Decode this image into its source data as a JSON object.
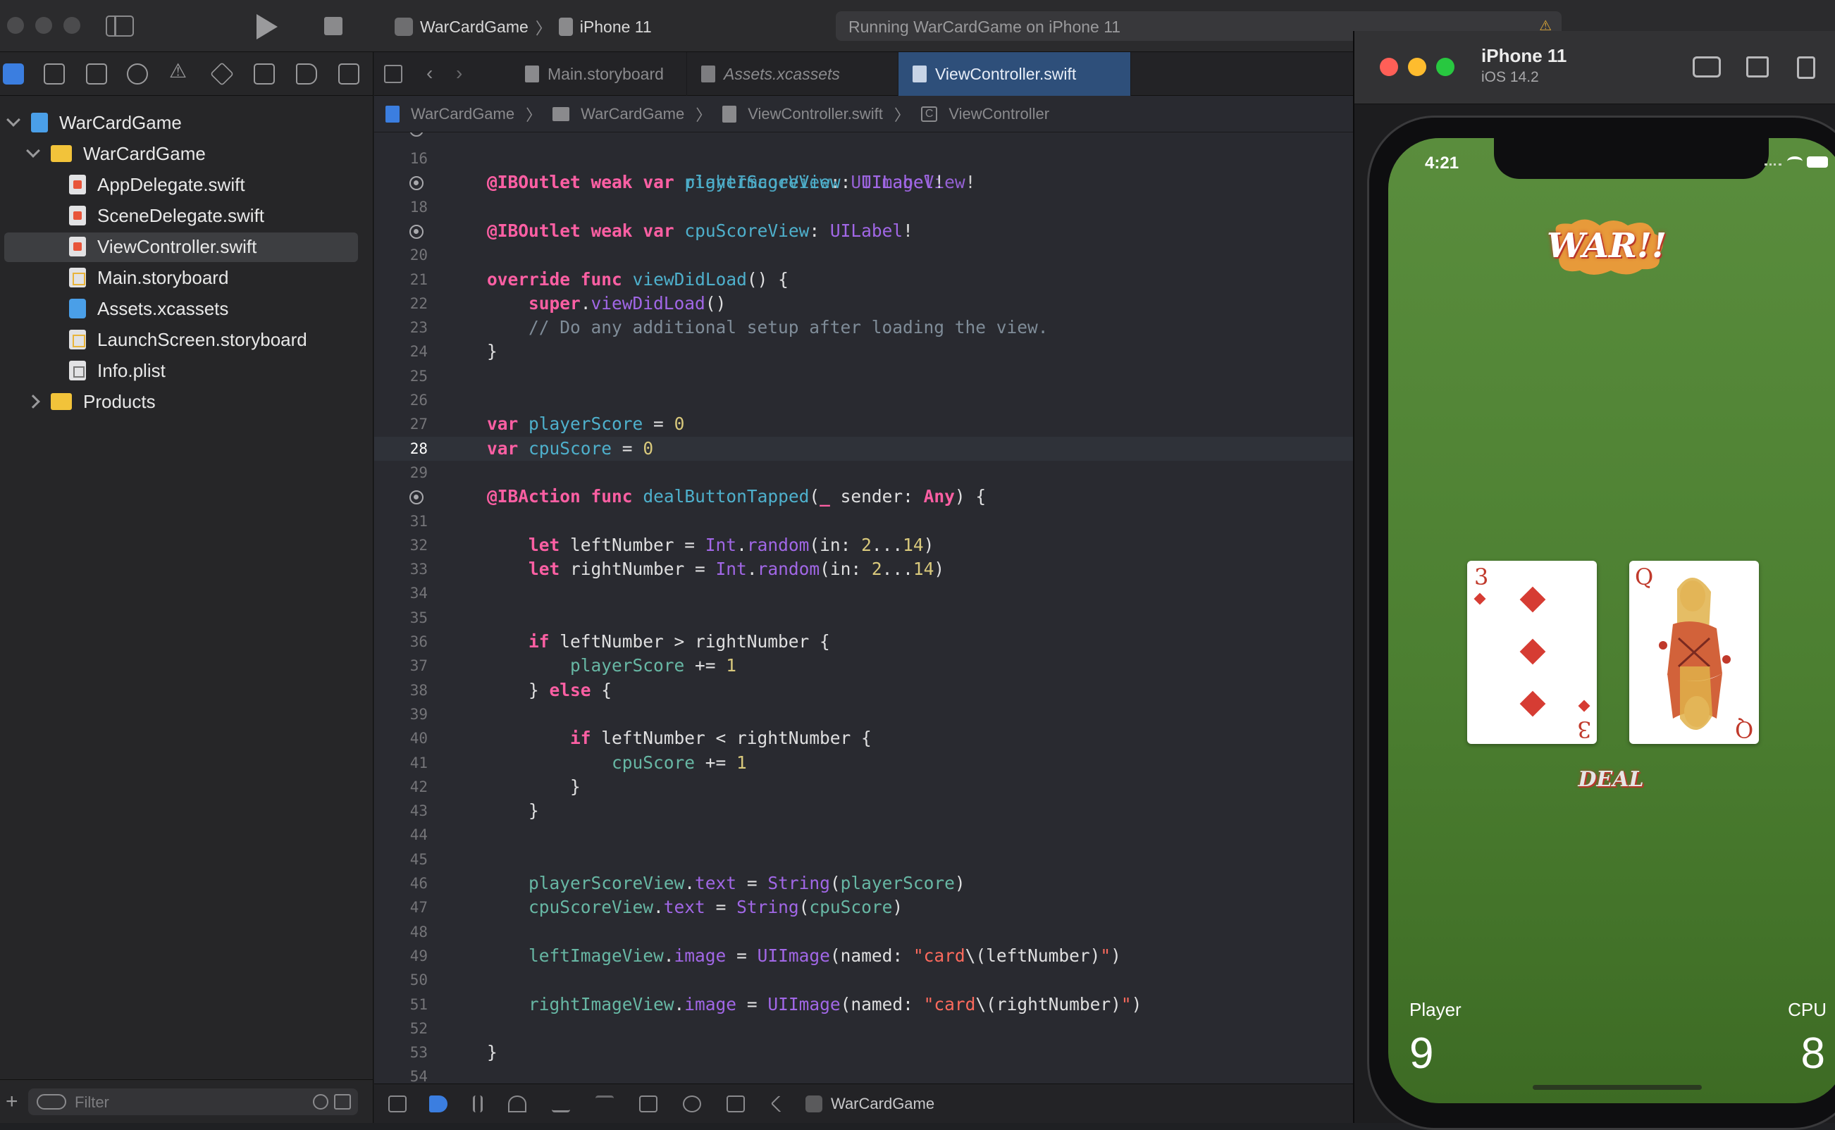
{
  "toolbar": {
    "scheme_target": "WarCardGame",
    "scheme_device": "iPhone 11",
    "activity_text": "Running WarCardGame on iPhone 11"
  },
  "navigator": {
    "filter_placeholder": "Filter",
    "tree": [
      {
        "label": "WarCardGame",
        "kind": "project",
        "level": 0,
        "expanded": true
      },
      {
        "label": "WarCardGame",
        "kind": "folder",
        "level": 1,
        "expanded": true
      },
      {
        "label": "AppDelegate.swift",
        "kind": "swift",
        "level": 2
      },
      {
        "label": "SceneDelegate.swift",
        "kind": "swift",
        "level": 2
      },
      {
        "label": "ViewController.swift",
        "kind": "swift",
        "level": 2,
        "selected": true
      },
      {
        "label": "Main.storyboard",
        "kind": "storyboard",
        "level": 2
      },
      {
        "label": "Assets.xcassets",
        "kind": "assets",
        "level": 2
      },
      {
        "label": "LaunchScreen.storyboard",
        "kind": "storyboard",
        "level": 2
      },
      {
        "label": "Info.plist",
        "kind": "plist",
        "level": 2
      },
      {
        "label": "Products",
        "kind": "folder",
        "level": 1,
        "expanded": false
      }
    ]
  },
  "editor": {
    "tabs": [
      {
        "label": "Main.storyboard",
        "active": false
      },
      {
        "label": "Assets.xcassets",
        "active": false
      },
      {
        "label": "ViewController.swift",
        "active": true
      }
    ],
    "jumpbar": [
      "WarCardGame",
      "WarCardGame",
      "ViewController.swift",
      "ViewController"
    ],
    "current_line": 28,
    "lines": [
      {
        "n": "16",
        "code": ""
      },
      {
        "n": "",
        "bp": true,
        "code": "<span class=\"kw\">@IBOutlet</span> <span class=\"kw\">weak</span> <span class=\"kw\">var</span> <span class=\"prop\">playerScoreView</span>: <span class=\"meth\">UILabel</span>!"
      },
      {
        "n": "18",
        "code": ""
      },
      {
        "n": "",
        "bp": true,
        "code": "<span class=\"kw\">@IBOutlet</span> <span class=\"kw\">weak</span> <span class=\"kw\">var</span> <span class=\"prop\">cpuScoreView</span>: <span class=\"meth\">UILabel</span>!"
      },
      {
        "n": "20",
        "code": ""
      },
      {
        "n": "21",
        "code": "<span class=\"kw\">override</span> <span class=\"kw\">func</span> <span class=\"prop\">viewDidLoad</span>() {"
      },
      {
        "n": "22",
        "code": "    <span class=\"kw\">super</span>.<span class=\"meth\">viewDidLoad</span>()"
      },
      {
        "n": "23",
        "code": "    <span class=\"cmt\">// Do any additional setup after loading the view.</span>"
      },
      {
        "n": "24",
        "code": "}"
      },
      {
        "n": "25",
        "code": ""
      },
      {
        "n": "26",
        "code": ""
      },
      {
        "n": "27",
        "code": "<span class=\"kw\">var</span> <span class=\"prop\">playerScore</span> = <span class=\"num\">0</span>"
      },
      {
        "n": "28",
        "code": "<span class=\"kw\">var</span> <span class=\"prop\">cpuScore</span> = <span class=\"num\">0</span>"
      },
      {
        "n": "29",
        "code": ""
      },
      {
        "n": "",
        "bp": true,
        "code": "<span class=\"kw\">@IBAction</span> <span class=\"kw\">func</span> <span class=\"prop\">dealButtonTapped</span>(<span class=\"kw\">_</span> sender: <span class=\"kw\">Any</span>) {"
      },
      {
        "n": "31",
        "code": ""
      },
      {
        "n": "32",
        "code": "    <span class=\"kw\">let</span> leftNumber = <span class=\"meth\">Int</span>.<span class=\"meth\">random</span>(in: <span class=\"num\">2</span>...<span class=\"num\">14</span>)"
      },
      {
        "n": "33",
        "code": "    <span class=\"kw\">let</span> rightNumber = <span class=\"meth\">Int</span>.<span class=\"meth\">random</span>(in: <span class=\"num\">2</span>...<span class=\"num\">14</span>)"
      },
      {
        "n": "34",
        "code": ""
      },
      {
        "n": "35",
        "code": ""
      },
      {
        "n": "36",
        "code": "    <span class=\"kw\">if</span> leftNumber &gt; rightNumber {"
      },
      {
        "n": "37",
        "code": "        <span class=\"fn\">playerScore</span> += <span class=\"num\">1</span>"
      },
      {
        "n": "38",
        "code": "    } <span class=\"kw\">else</span> {"
      },
      {
        "n": "39",
        "code": ""
      },
      {
        "n": "40",
        "code": "        <span class=\"kw\">if</span> leftNumber &lt; rightNumber {"
      },
      {
        "n": "41",
        "code": "            <span class=\"fn\">cpuScore</span> += <span class=\"num\">1</span>"
      },
      {
        "n": "42",
        "code": "        }"
      },
      {
        "n": "43",
        "code": "    }"
      },
      {
        "n": "44",
        "code": ""
      },
      {
        "n": "45",
        "code": ""
      },
      {
        "n": "46",
        "code": "    <span class=\"fn\">playerScoreView</span>.<span class=\"meth\">text</span> = <span class=\"meth\">String</span>(<span class=\"fn\">playerScore</span>)"
      },
      {
        "n": "47",
        "code": "    <span class=\"fn\">cpuScoreView</span>.<span class=\"meth\">text</span> = <span class=\"meth\">String</span>(<span class=\"fn\">cpuScore</span>)"
      },
      {
        "n": "48",
        "code": ""
      },
      {
        "n": "49",
        "code": "    <span class=\"fn\">leftImageView</span>.<span class=\"meth\">image</span> = <span class=\"meth\">UIImage</span>(named: <span class=\"str\">\"card</span>\\(leftNumber)<span class=\"str\">\"</span>)"
      },
      {
        "n": "50",
        "code": ""
      },
      {
        "n": "51",
        "code": "    <span class=\"fn\">rightImageView</span>.<span class=\"meth\">image</span> = <span class=\"meth\">UIImage</span>(named: <span class=\"str\">\"card</span>\\(rightNumber)<span class=\"str\">\"</span>)"
      },
      {
        "n": "52",
        "code": ""
      },
      {
        "n": "53",
        "code": "}"
      },
      {
        "n": "54",
        "code": ""
      }
    ]
  },
  "debugbar": {
    "scheme_label": "WarCardGame"
  },
  "simulator": {
    "device_name": "iPhone 11",
    "os_version": "iOS 14.2",
    "status_time": "4:21",
    "logo_text": "WAR!!",
    "left_card_rank": "3",
    "right_card_rank": "Q",
    "deal_label": "DEAL",
    "player_label": "Player",
    "player_score": "9",
    "cpu_label": "CPU",
    "cpu_score": "8"
  }
}
